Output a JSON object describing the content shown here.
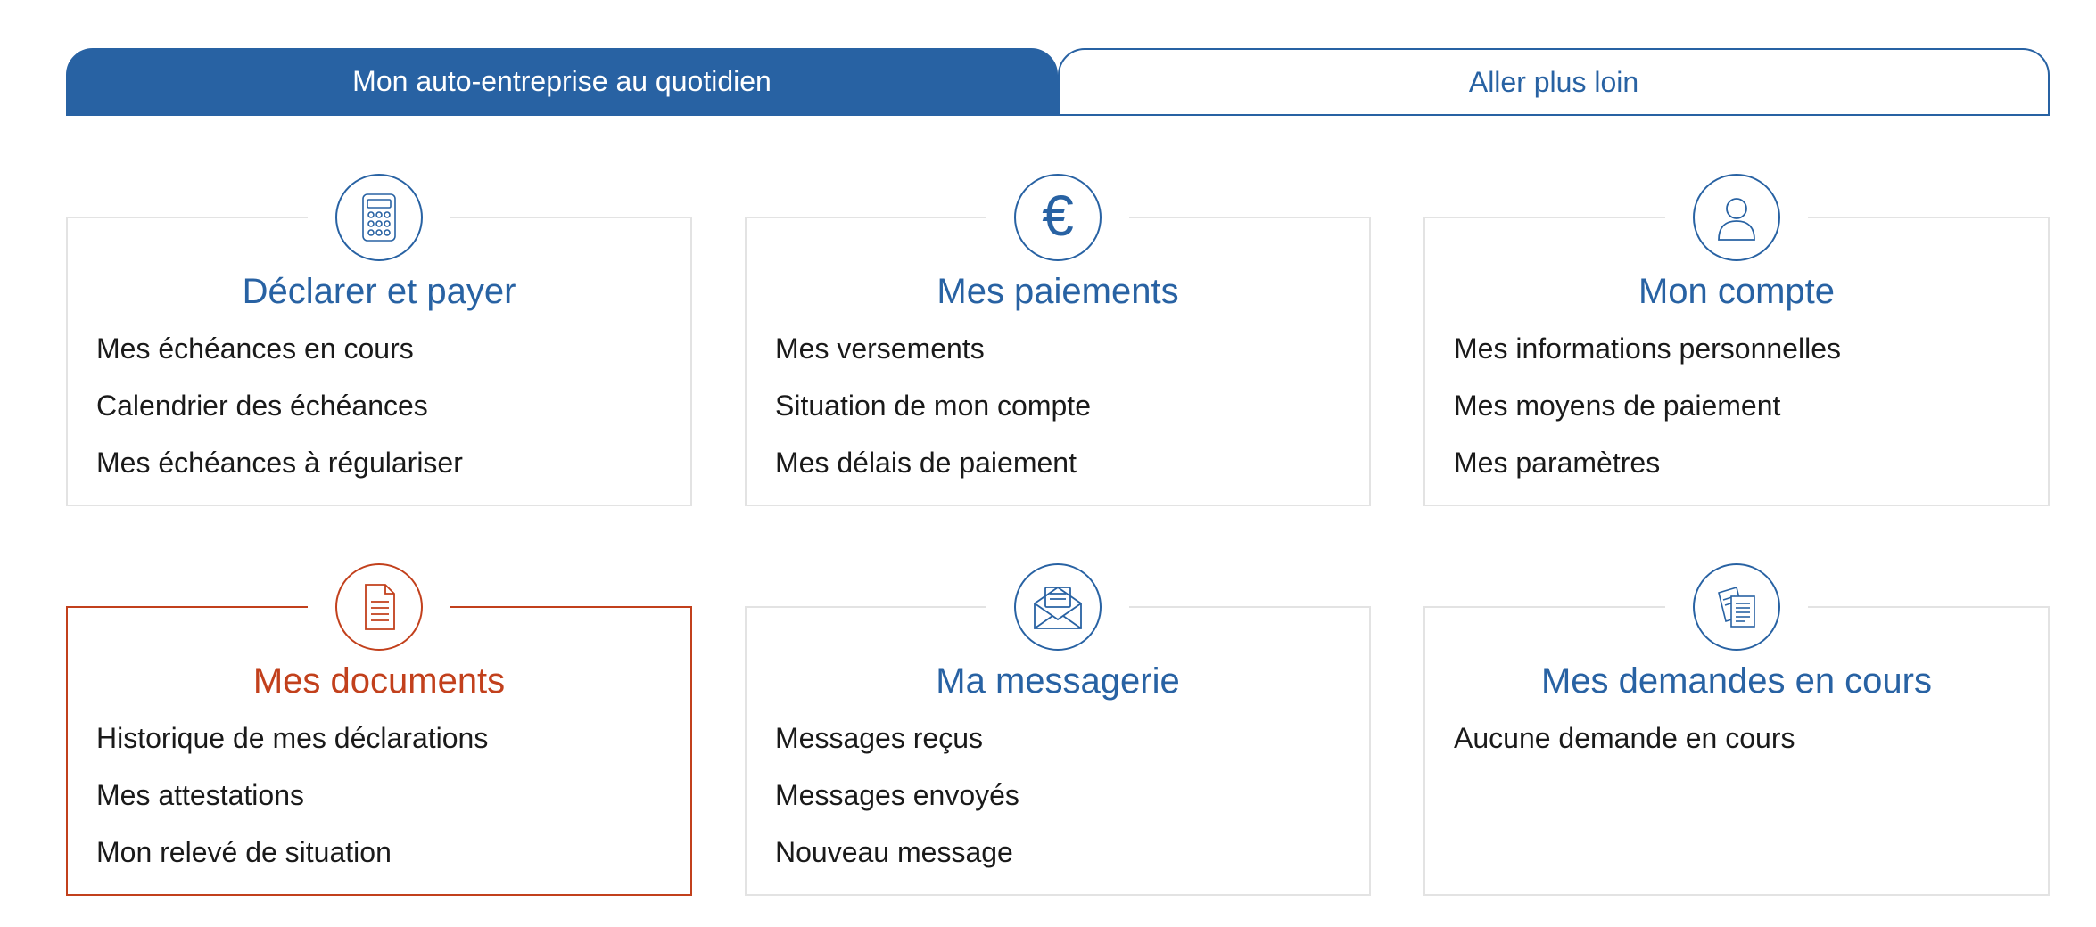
{
  "tabs": [
    {
      "label": "Mon auto-entreprise au quotidien",
      "active": true
    },
    {
      "label": "Aller plus loin",
      "active": false
    }
  ],
  "colors": {
    "primary": "#2862a3",
    "highlight": "#c2401c",
    "border": "#e3e3e3",
    "text": "#1a1a1a"
  },
  "cards": [
    {
      "icon": "calculator-icon",
      "title": "Déclarer et payer",
      "links": [
        "Mes échéances en cours",
        "Calendrier des échéances",
        "Mes échéances à régulariser"
      ]
    },
    {
      "icon": "euro-icon",
      "title": "Mes paiements",
      "links": [
        "Mes versements",
        "Situation de mon compte",
        "Mes délais de paiement"
      ]
    },
    {
      "icon": "user-icon",
      "title": "Mon compte",
      "links": [
        "Mes informations personnelles",
        "Mes moyens de paiement",
        "Mes paramètres"
      ]
    },
    {
      "icon": "document-icon",
      "title": "Mes documents",
      "highlighted": true,
      "links": [
        "Historique de mes déclarations",
        "Mes attestations",
        "Mon relevé de situation"
      ]
    },
    {
      "icon": "envelope-icon",
      "title": "Ma messagerie",
      "links": [
        "Messages reçus",
        "Messages envoyés",
        "Nouveau message"
      ]
    },
    {
      "icon": "requests-icon",
      "title": "Mes demandes en cours",
      "links": [
        "Aucune demande en cours"
      ]
    }
  ]
}
